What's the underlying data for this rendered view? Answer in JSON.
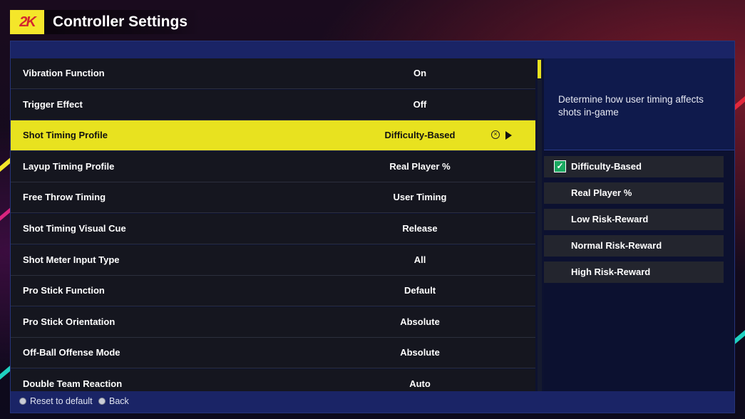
{
  "header": {
    "logo_text": "2K",
    "title": "Controller Settings"
  },
  "settings": [
    {
      "label": "Vibration Function",
      "value": "On"
    },
    {
      "label": "Trigger Effect",
      "value": "Off"
    },
    {
      "label": "Shot Timing Profile",
      "value": "Difficulty-Based",
      "selected": true
    },
    {
      "label": "Layup Timing Profile",
      "value": "Real Player %"
    },
    {
      "label": "Free Throw Timing",
      "value": "User Timing"
    },
    {
      "label": "Shot Timing Visual Cue",
      "value": "Release"
    },
    {
      "label": "Shot Meter Input Type",
      "value": "All"
    },
    {
      "label": "Pro Stick Function",
      "value": "Default"
    },
    {
      "label": "Pro Stick Orientation",
      "value": "Absolute"
    },
    {
      "label": "Off-Ball Offense Mode",
      "value": "Absolute"
    },
    {
      "label": "Double Team Reaction",
      "value": "Auto"
    }
  ],
  "selected_row_icons": [
    "cross-button-icon",
    "arrow-right-icon"
  ],
  "side_panel": {
    "description": "Determine how user timing affects shots in-game",
    "options": [
      {
        "label": "Difficulty-Based",
        "checked": true
      },
      {
        "label": "Real Player %",
        "checked": false
      },
      {
        "label": "Low Risk-Reward",
        "checked": false
      },
      {
        "label": "Normal Risk-Reward",
        "checked": false
      },
      {
        "label": "High Risk-Reward",
        "checked": false
      }
    ]
  },
  "footer": {
    "reset_label": "Reset to default",
    "back_label": "Back"
  },
  "colors": {
    "accent_yellow": "#e8e21f",
    "panel_blue": "#1a2466",
    "check_green": "#1aa860"
  }
}
